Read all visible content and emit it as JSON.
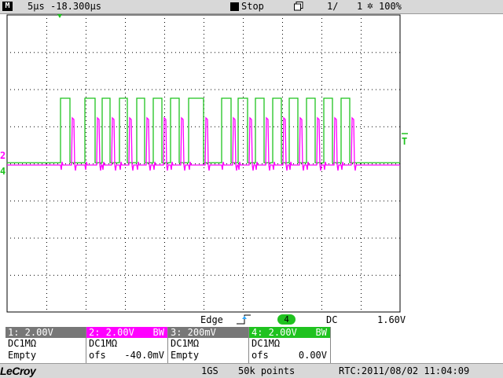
{
  "colors": {
    "ch1": "#1fc21f",
    "ch2": "#ff00ff",
    "ch4": "#1fc21f",
    "grid": "#000000",
    "trigger": "#33aaff"
  },
  "topbar": {
    "mode_label": "M",
    "timebase": "5µs",
    "delay": "-18.300µs",
    "run_state": "Stop",
    "acq_count": "1/",
    "acq_total": "1",
    "zoom": "100%"
  },
  "markers": {
    "ch2_label": "2",
    "ch4_label": "4",
    "trigger_label": "T"
  },
  "trigger": {
    "type": "Edge",
    "slope_icon": "rising-edge-icon",
    "source": "4",
    "coupling": "DC",
    "level": "1.60V"
  },
  "channels": [
    {
      "header": "1: 2.00V",
      "bw": "",
      "coupling": "DC1MΩ",
      "ofs_label": "Empty",
      "ofs_value": ""
    },
    {
      "header": "2: 2.00V",
      "bw": "BW",
      "coupling": "DC1MΩ",
      "ofs_label": "ofs",
      "ofs_value": "-40.0mV"
    },
    {
      "header": "3: 200mV",
      "bw": "",
      "coupling": "DC1MΩ",
      "ofs_label": "Empty",
      "ofs_value": ""
    },
    {
      "header": "4: 2.00V",
      "bw": "BW",
      "coupling": "DC1MΩ",
      "ofs_label": "ofs",
      "ofs_value": "0.00V"
    }
  ],
  "bottombar": {
    "brand": "LeCroy",
    "sample_rate": "1GS",
    "record_length": "50k points",
    "rtc": "RTC:2011/08/02 11:04:09"
  }
}
